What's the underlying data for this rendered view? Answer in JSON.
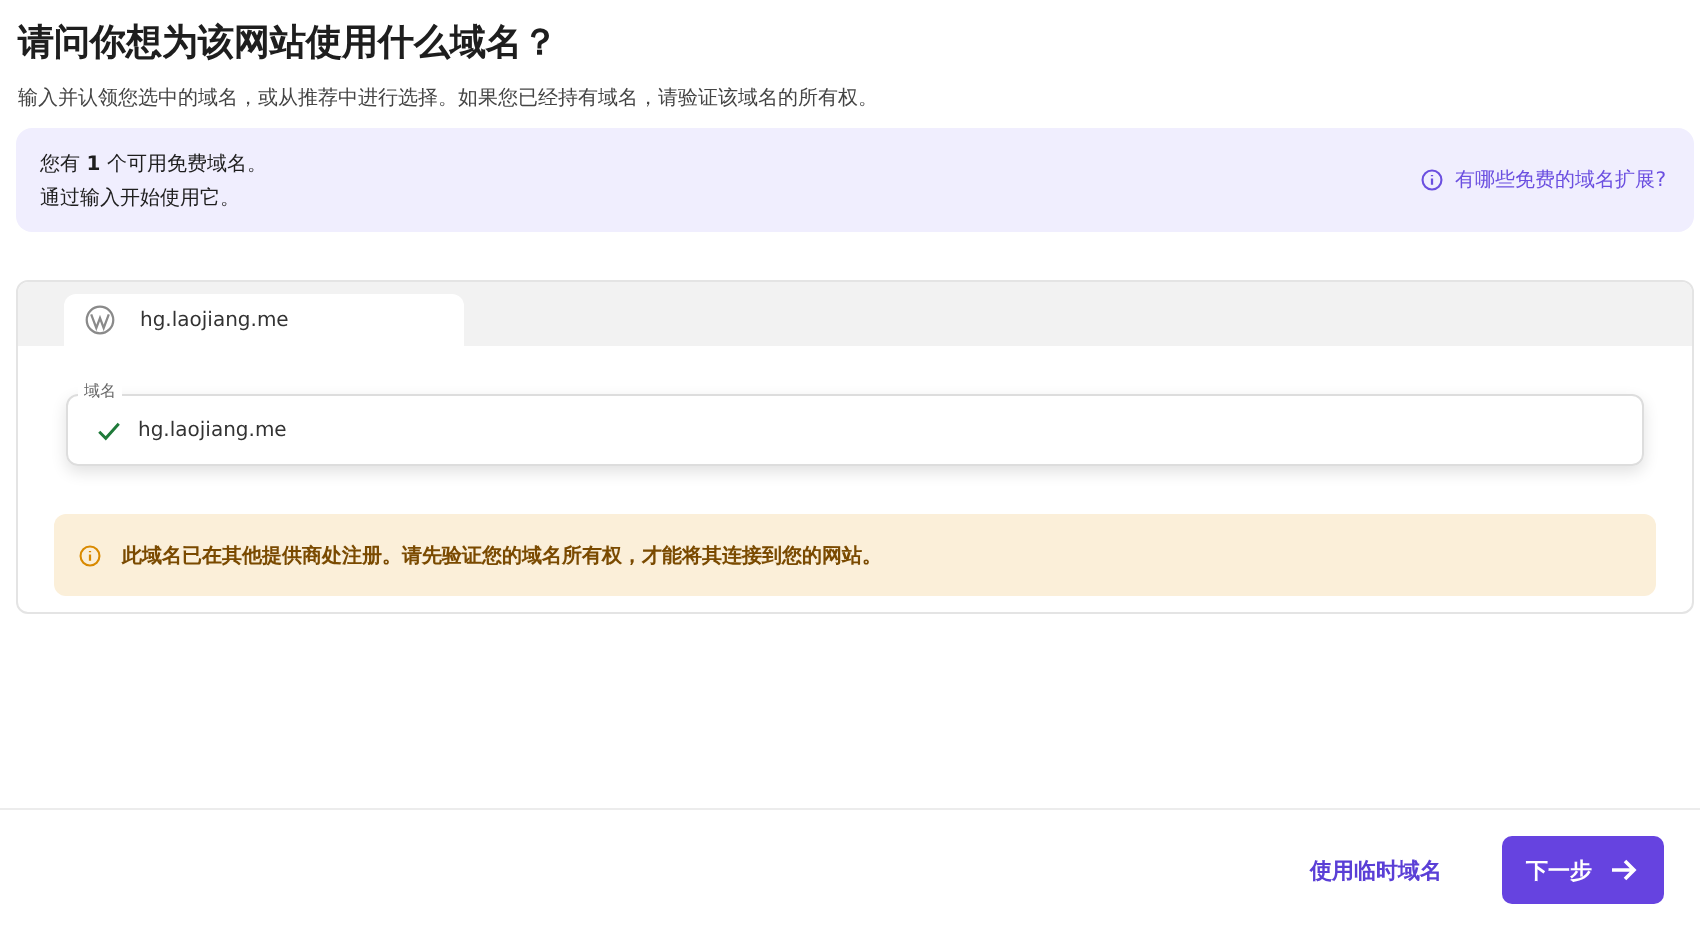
{
  "title": "请问你想为该网站使用什么域名？",
  "subtitle": "输入并认领您选中的域名，或从推荐中进行选择。如果您已经持有域名，请验证该域名的所有权。",
  "info_banner": {
    "lines": [
      "您有 **1** 个可用免费域名。",
      "通过输入开始使用它。"
    ],
    "link": "有哪些免费的域名扩展?"
  },
  "site_tab": {
    "label": "hg.laojiang.me",
    "selected": true
  },
  "domain_field": {
    "label": "域名",
    "value": "hg.laojiang.me",
    "valid": true
  },
  "warning": "此域名已在其他提供商处注册。请先验证您的域名所有权，才能将其连接到您的网站。",
  "footer": {
    "secondary": "使用临时域名",
    "primary": "下一步"
  }
}
